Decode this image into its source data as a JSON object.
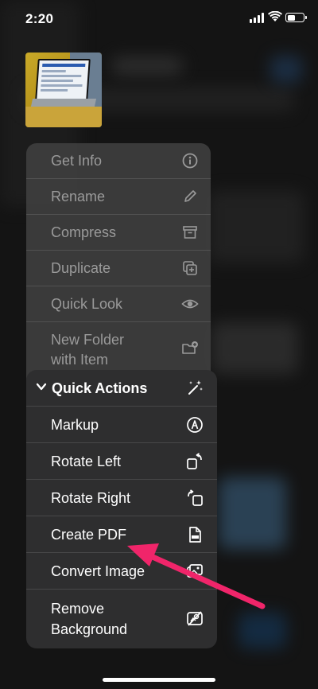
{
  "status_bar": {
    "time": "2:20",
    "battery_level": 0.45
  },
  "context_menu": {
    "items": [
      {
        "label": "Get Info",
        "icon": "info-icon"
      },
      {
        "label": "Rename",
        "icon": "pencil-icon"
      },
      {
        "label": "Compress",
        "icon": "archive-box-icon"
      },
      {
        "label": "Duplicate",
        "icon": "duplicate-icon"
      },
      {
        "label": "Quick Look",
        "icon": "eye-icon"
      },
      {
        "label_line1": "New Folder",
        "label_line2": "with Item",
        "icon": "folder-plus-icon"
      }
    ]
  },
  "quick_actions_menu": {
    "header": {
      "label": "Quick Actions",
      "icon": "magic-wand-icon"
    },
    "items": [
      {
        "label": "Markup",
        "icon": "markup-icon"
      },
      {
        "label": "Rotate Left",
        "icon": "rotate-left-icon"
      },
      {
        "label": "Rotate Right",
        "icon": "rotate-right-icon"
      },
      {
        "label": "Create PDF",
        "icon": "pdf-icon"
      },
      {
        "label": "Convert Image",
        "icon": "convert-image-icon"
      },
      {
        "label_line1": "Remove",
        "label_line2": "Background",
        "icon": "remove-background-icon"
      }
    ]
  },
  "colors": {
    "annotation_arrow": "#f0256a",
    "menu_text_dim": "#9a9a9a"
  }
}
